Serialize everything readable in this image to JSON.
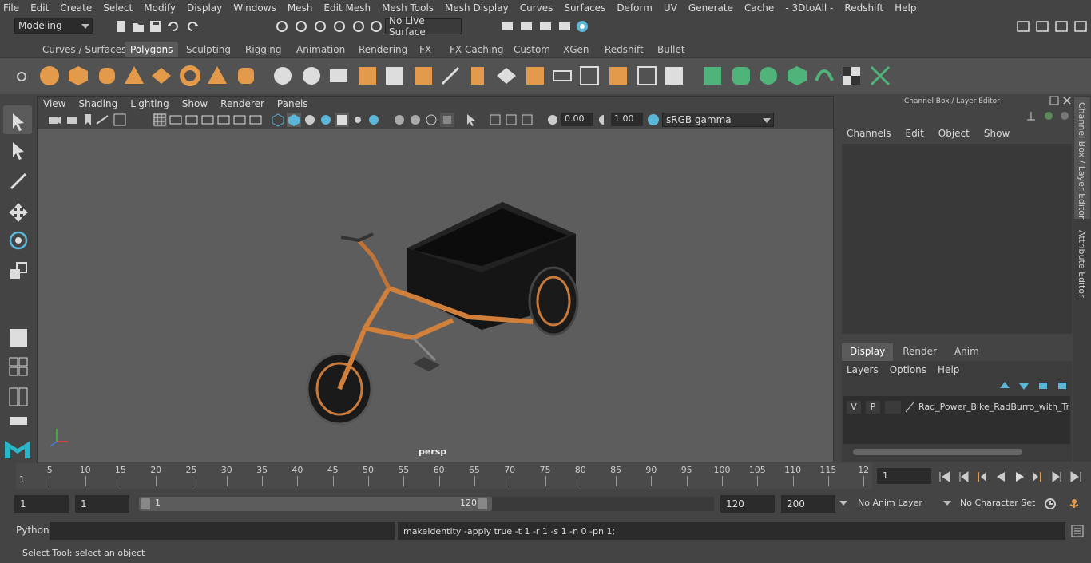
{
  "menus": [
    "File",
    "Edit",
    "Create",
    "Select",
    "Modify",
    "Display",
    "Windows",
    "Mesh",
    "Edit Mesh",
    "Mesh Tools",
    "Mesh Display",
    "Curves",
    "Surfaces",
    "Deform",
    "UV",
    "Generate",
    "Cache",
    "- 3DtoAll -",
    "Redshift",
    "Help"
  ],
  "mode_dropdown": "Modeling",
  "live_surface": "No Live Surface",
  "shelf_tabs": [
    "Curves / Surfaces",
    "Polygons",
    "Sculpting",
    "Rigging",
    "Animation",
    "Rendering",
    "FX",
    "FX Caching",
    "Custom",
    "XGen",
    "Redshift",
    "Bullet"
  ],
  "active_shelf_tab": "Polygons",
  "viewport": {
    "menus": [
      "View",
      "Shading",
      "Lighting",
      "Show",
      "Renderer",
      "Panels"
    ],
    "exposure": "0.00",
    "gamma": "1.00",
    "color_space": "sRGB gamma",
    "camera_label": "persp"
  },
  "channel_box": {
    "title": "Channel Box / Layer Editor",
    "menus": [
      "Channels",
      "Edit",
      "Object",
      "Show"
    ],
    "layer_tabs": [
      "Display",
      "Render",
      "Anim"
    ],
    "active_layer_tab": "Display",
    "layer_menus": [
      "Layers",
      "Options",
      "Help"
    ],
    "layer": {
      "v": "V",
      "p": "P",
      "name": "Rad_Power_Bike_RadBurro_with_Truck"
    }
  },
  "side_tabs": [
    "Channel Box / Layer Editor",
    "Attribute Editor"
  ],
  "timeline": {
    "ticks": [
      "5",
      "10",
      "15",
      "20",
      "25",
      "30",
      "35",
      "40",
      "45",
      "50",
      "55",
      "60",
      "65",
      "70",
      "75",
      "80",
      "85",
      "90",
      "95",
      "100",
      "105",
      "110",
      "115",
      "12"
    ],
    "start_marker": "1",
    "current_frame": "1"
  },
  "range": {
    "start": "1",
    "playback_start": "1",
    "slider_start": "1",
    "slider_end": "120",
    "playback_end": "120",
    "end": "200",
    "anim_layer": "No Anim Layer",
    "character_set": "No Character Set"
  },
  "command": {
    "language": "Python",
    "result": "makeIdentity -apply true -t 1 -r 1 -s 1 -n 0 -pn 1;"
  },
  "status": "Select Tool: select an object",
  "colors": {
    "accent": "#5bb6d8",
    "orange": "#e39a4a",
    "active_tab": "#5a5a5a"
  }
}
